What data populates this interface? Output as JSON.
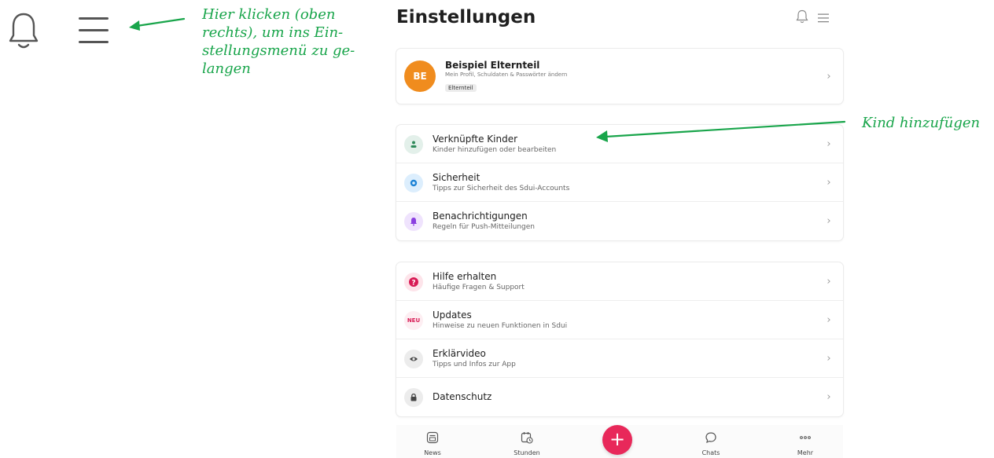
{
  "annotations": {
    "menu_hint": [
      "Hier klicken (oben",
      "rechts), um ins Ein-",
      "stellungsmenü zu ge-",
      "langen"
    ],
    "kind_hint": "Kind hinzufügen",
    "color": "#19a54b"
  },
  "header": {
    "title": "Einstellungen"
  },
  "profile": {
    "initials": "BE",
    "name": "Beispiel Elternteil",
    "subtitle": "Mein Profil, Schuldaten & Passwörter ändern",
    "role_badge": "Elternteil",
    "avatar_color": "#f08c1e"
  },
  "section_one": [
    {
      "title": "Verknüpfte Kinder",
      "subtitle": "Kinder hinzufügen oder bearbeiten",
      "icon": "child-icon"
    },
    {
      "title": "Sicherheit",
      "subtitle": "Tipps zur Sicherheit des Sdui-Accounts",
      "icon": "shield-icon"
    },
    {
      "title": "Benachrichtigungen",
      "subtitle": "Regeln für Push-Mitteilungen",
      "icon": "bell-icon"
    }
  ],
  "section_two": [
    {
      "title": "Hilfe erhalten",
      "subtitle": "Häufige Fragen & Support",
      "icon": "help-icon"
    },
    {
      "title": "Updates",
      "subtitle": "Hinweise zu neuen Funktionen in Sdui",
      "icon": "new-badge-icon",
      "icon_text": "NEU"
    },
    {
      "title": "Erklärvideo",
      "subtitle": "Tipps und Infos zur App",
      "icon": "eye-icon"
    },
    {
      "title": "Datenschutz",
      "subtitle": "",
      "icon": "lock-icon"
    }
  ],
  "bottom_nav": {
    "news": "News",
    "stunden": "Stunden",
    "chats": "Chats",
    "mehr": "Mehr",
    "fab": "+",
    "fab_color": "#e8285a"
  }
}
